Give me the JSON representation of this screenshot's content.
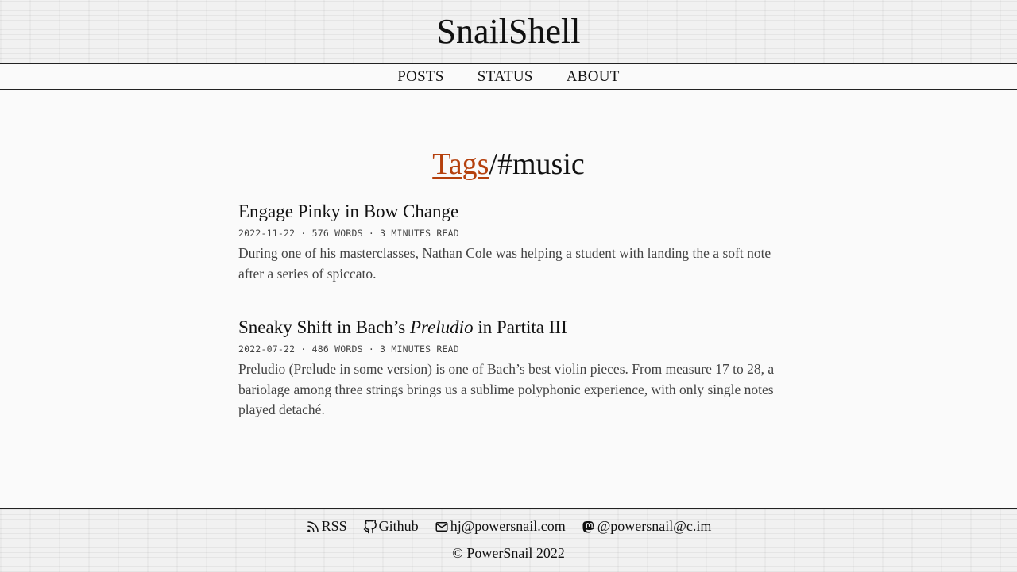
{
  "site": {
    "title": "SnailShell"
  },
  "nav": {
    "items": [
      {
        "label": "POSTS"
      },
      {
        "label": "STATUS"
      },
      {
        "label": "ABOUT"
      }
    ]
  },
  "heading": {
    "link": "Tags",
    "separator": "/",
    "tag": "#music"
  },
  "posts": [
    {
      "title_pre": "Engage Pinky in Bow Change",
      "title_em": "",
      "title_post": "",
      "meta": "2022-11-22 · 576 WORDS · 3 MINUTES READ",
      "excerpt": "During one of his masterclasses, Nathan Cole was helping a student with landing the a soft note after a series of spiccato."
    },
    {
      "title_pre": "Sneaky Shift in Bach’s ",
      "title_em": "Preludio",
      "title_post": " in Partita III",
      "meta": "2022-07-22 · 486 WORDS · 3 MINUTES READ",
      "excerpt": "Preludio (Prelude in some version) is one of Bach’s best violin pieces. From measure 17 to 28, a bariolage among three strings brings us a sublime polyphonic experience, with only single notes played detaché."
    }
  ],
  "footer": {
    "links": [
      {
        "label": "RSS",
        "icon": "rss-icon"
      },
      {
        "label": "Github",
        "icon": "github-icon"
      },
      {
        "label": "hj@powersnail.com",
        "icon": "mail-icon"
      },
      {
        "label": "@powersnail@c.im",
        "icon": "mastodon-icon"
      }
    ],
    "copyright": "© PowerSnail 2022"
  }
}
